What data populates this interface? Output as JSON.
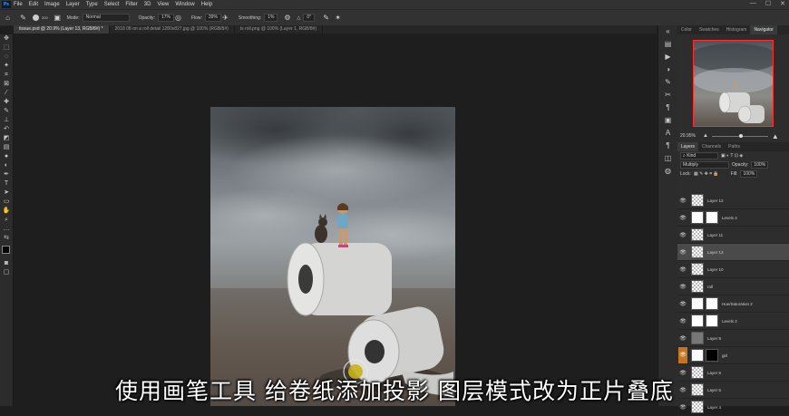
{
  "app_icon": "Ps",
  "menu": [
    "File",
    "Edit",
    "Image",
    "Layer",
    "Type",
    "Select",
    "Filter",
    "3D",
    "View",
    "Window",
    "Help"
  ],
  "window_controls": [
    "—",
    "☐",
    "✕"
  ],
  "options_bar": {
    "mode_label": "Mode:",
    "mode_value": "Normal",
    "opacity_label": "Opacity:",
    "opacity_value": "17%",
    "flow_label": "Flow:",
    "flow_value": "39%",
    "smoothing_label": "Smoothing:",
    "smoothing_value": "1%",
    "angle_value": "0°",
    "brush_size": "200"
  },
  "tabs": [
    "tissue.psd @ 20.9% (Layer 13, RGB/8#) *",
    "2018 08 on a roll detail 1280x827.jpg @ 100% (RGB/8#)",
    "ts roll.png @ 100% (Layer 1, RGB/8#)"
  ],
  "right_panel": {
    "top_tabs": [
      "Color",
      "Swatches",
      "Histogram",
      "Navigator"
    ],
    "zoom": "20.95%",
    "layer_tabs": [
      "Layers",
      "Channels",
      "Paths"
    ],
    "kind_label": "Kind",
    "blend_mode": "Multiply",
    "opacity_label": "Opacity:",
    "opacity_value": "100%",
    "lock_label": "Lock:",
    "fill_label": "Fill:",
    "fill_value": "100%",
    "layers": [
      {
        "name": "Layer 12",
        "thumb": "checker",
        "mask": "",
        "selected": false,
        "orange": false
      },
      {
        "name": "Levels 4",
        "thumb": "white",
        "mask": "white",
        "selected": false,
        "orange": false
      },
      {
        "name": "Layer 11",
        "thumb": "checker",
        "mask": "",
        "selected": false,
        "orange": false
      },
      {
        "name": "Layer 13",
        "thumb": "checker",
        "mask": "",
        "selected": true,
        "orange": false
      },
      {
        "name": "Layer 10",
        "thumb": "checker",
        "mask": "",
        "selected": false,
        "orange": false
      },
      {
        "name": "roll",
        "thumb": "checker",
        "mask": "",
        "selected": false,
        "orange": false
      },
      {
        "name": "Hue/Saturation 2",
        "thumb": "white",
        "mask": "white",
        "selected": false,
        "orange": false
      },
      {
        "name": "Levels 2",
        "thumb": "white",
        "mask": "white",
        "selected": false,
        "orange": false
      },
      {
        "name": "Layer 8",
        "thumb": "gray",
        "mask": "",
        "selected": false,
        "orange": false
      },
      {
        "name": "girl",
        "thumb": "white",
        "mask": "black",
        "selected": false,
        "orange": true
      },
      {
        "name": "Layer 6",
        "thumb": "checker",
        "mask": "",
        "selected": false,
        "orange": false
      },
      {
        "name": "Layer 5",
        "thumb": "checker",
        "mask": "",
        "selected": false,
        "orange": false
      },
      {
        "name": "Layer 4",
        "thumb": "checker",
        "mask": "",
        "selected": false,
        "orange": false
      }
    ]
  },
  "subtitle": "使用画笔工具  给卷纸添加投影  图层模式改为正片叠底",
  "colors": {
    "ui_dark": "#323232",
    "canvas_bg": "#1e1e1e",
    "selection_orange": "#c87520",
    "navigator_frame": "#ff2d2d",
    "brush_cursor": "#c9b21a"
  }
}
